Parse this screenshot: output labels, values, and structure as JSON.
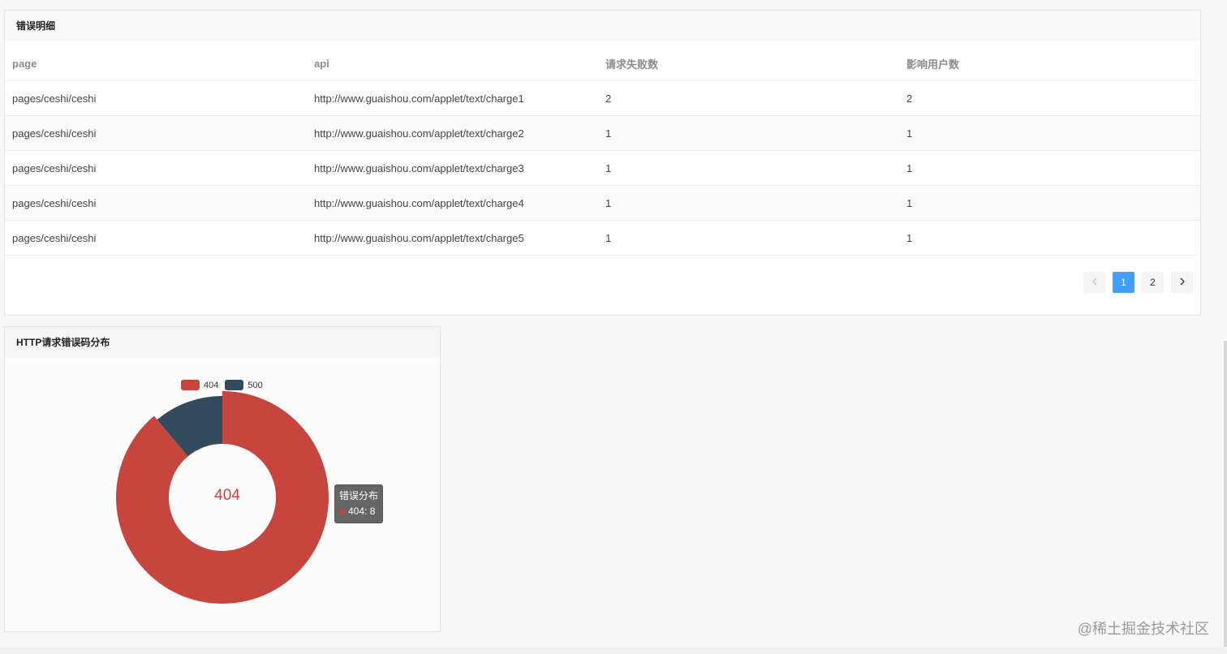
{
  "table_card": {
    "title": "错误明细",
    "columns": [
      "page",
      "api",
      "请求失败数",
      "影响用户数"
    ],
    "rows": [
      [
        "pages/ceshi/ceshi",
        "http://www.guaishou.com/applet/text/charge1",
        "2",
        "2"
      ],
      [
        "pages/ceshi/ceshi",
        "http://www.guaishou.com/applet/text/charge2",
        "1",
        "1"
      ],
      [
        "pages/ceshi/ceshi",
        "http://www.guaishou.com/applet/text/charge3",
        "1",
        "1"
      ],
      [
        "pages/ceshi/ceshi",
        "http://www.guaishou.com/applet/text/charge4",
        "1",
        "1"
      ],
      [
        "pages/ceshi/ceshi",
        "http://www.guaishou.com/applet/text/charge5",
        "1",
        "1"
      ]
    ],
    "pagination": {
      "prev_icon": "chevron-left-icon",
      "pages": [
        "1",
        "2"
      ],
      "current": "1",
      "next_icon": "chevron-right-icon"
    }
  },
  "chart_card": {
    "title": "HTTP请求错误码分布"
  },
  "chart_data": {
    "type": "pie",
    "donut": true,
    "legend_position": "top",
    "categories": [
      "404",
      "500"
    ],
    "values": [
      8,
      1
    ],
    "colors": [
      "#c6463d",
      "#33495c"
    ],
    "center_label": "404",
    "tooltip": {
      "title": "错误分布",
      "text": "404: 8"
    }
  },
  "watermark": "@稀土掘金技术社区",
  "colors": {
    "accent": "#409eff"
  }
}
